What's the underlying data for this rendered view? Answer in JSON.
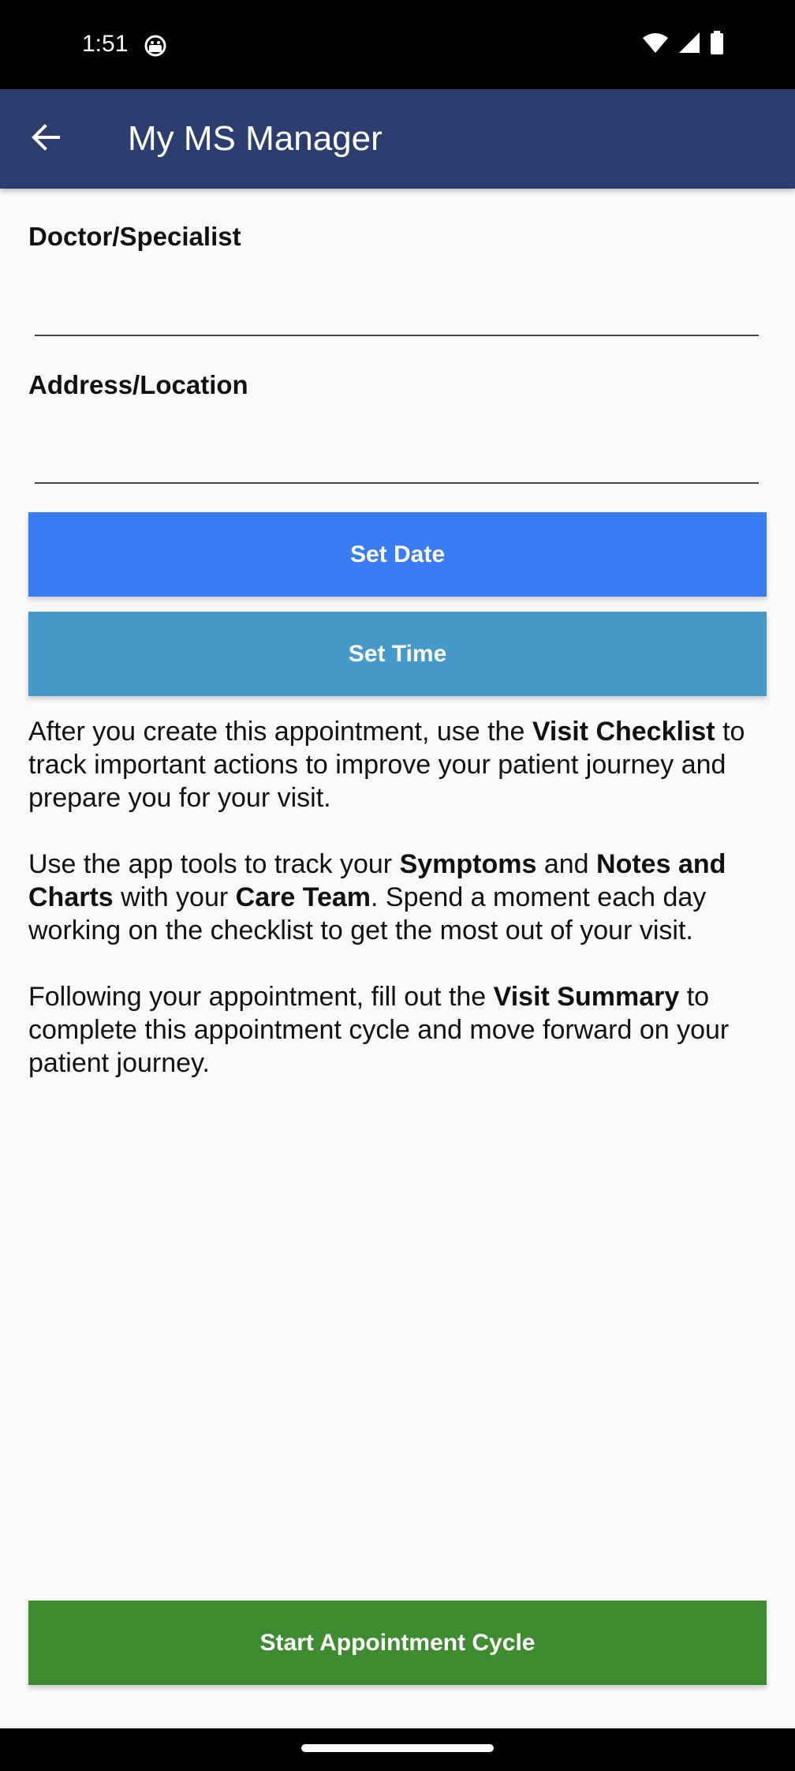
{
  "status_bar": {
    "time": "1:51",
    "app_icon": "android-debug-icon",
    "icons": [
      "wifi-icon",
      "cell-signal-icon",
      "battery-icon"
    ]
  },
  "app_bar": {
    "title": "My MS Manager",
    "back_icon": "arrow-back-icon",
    "background": "#2c3e6f"
  },
  "form": {
    "doctor_label": "Doctor/Specialist",
    "doctor_value": "",
    "address_label": "Address/Location",
    "address_value": ""
  },
  "buttons": {
    "set_date": "Set Date",
    "set_time": "Set Time",
    "start_cycle": "Start Appointment Cycle"
  },
  "info": {
    "p1": {
      "t1": "After you create this appointment, use the ",
      "b1": "Visit Checklist",
      "t2": " to track important actions to improve your patient journey and prepare you for your visit."
    },
    "p2": {
      "t1": "Use the app tools to track your ",
      "b1": "Symptoms",
      "t2": " and ",
      "b2": "Notes and Charts",
      "t3": " with your ",
      "b3": "Care Team",
      "t4": ". Spend a moment each day working on the checklist to get the most out of your visit."
    },
    "p3": {
      "t1": "Following your appointment, fill out the ",
      "b1": "Visit Summary",
      "t2": " to complete this appointment cycle and move forward on your patient journey."
    }
  },
  "colors": {
    "set_date_button": "#3a7cf3",
    "set_time_button": "#4699c9",
    "start_button": "#3f8c30"
  }
}
